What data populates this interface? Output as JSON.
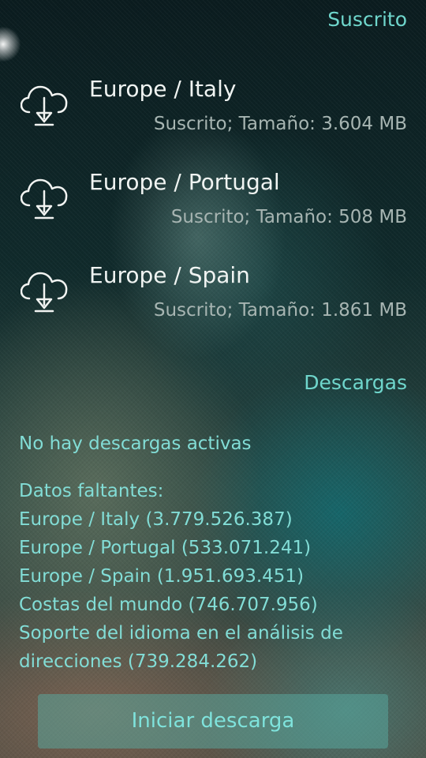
{
  "subscribed_section": {
    "title": "Suscrito",
    "items": [
      {
        "name": "Europe / Italy",
        "status": "Suscrito; Tamaño: 3.604 MB",
        "icon": "cloud-download-icon"
      },
      {
        "name": "Europe / Portugal",
        "status": "Suscrito; Tamaño: 508 MB",
        "icon": "cloud-download-icon"
      },
      {
        "name": "Europe / Spain",
        "status": "Suscrito; Tamaño: 1.861 MB",
        "icon": "cloud-download-icon"
      }
    ]
  },
  "downloads_section": {
    "title": "Descargas",
    "no_active": "No hay descargas activas",
    "missing_title": "Datos faltantes:",
    "missing_items": [
      "Europe / Italy (3.779.526.387)",
      "Europe / Portugal (533.071.241)",
      "Europe / Spain (1.951.693.451)",
      "Costas del mundo (746.707.956)",
      "Soporte del idioma en el análisis de",
      "direcciones (739.284.262)"
    ]
  },
  "actions": {
    "start_download": "Iniciar descarga"
  },
  "theme": {
    "accent": "#6fd6cc",
    "text_primary": "#f0f4f2",
    "text_secondary": "#a7b5b2"
  }
}
